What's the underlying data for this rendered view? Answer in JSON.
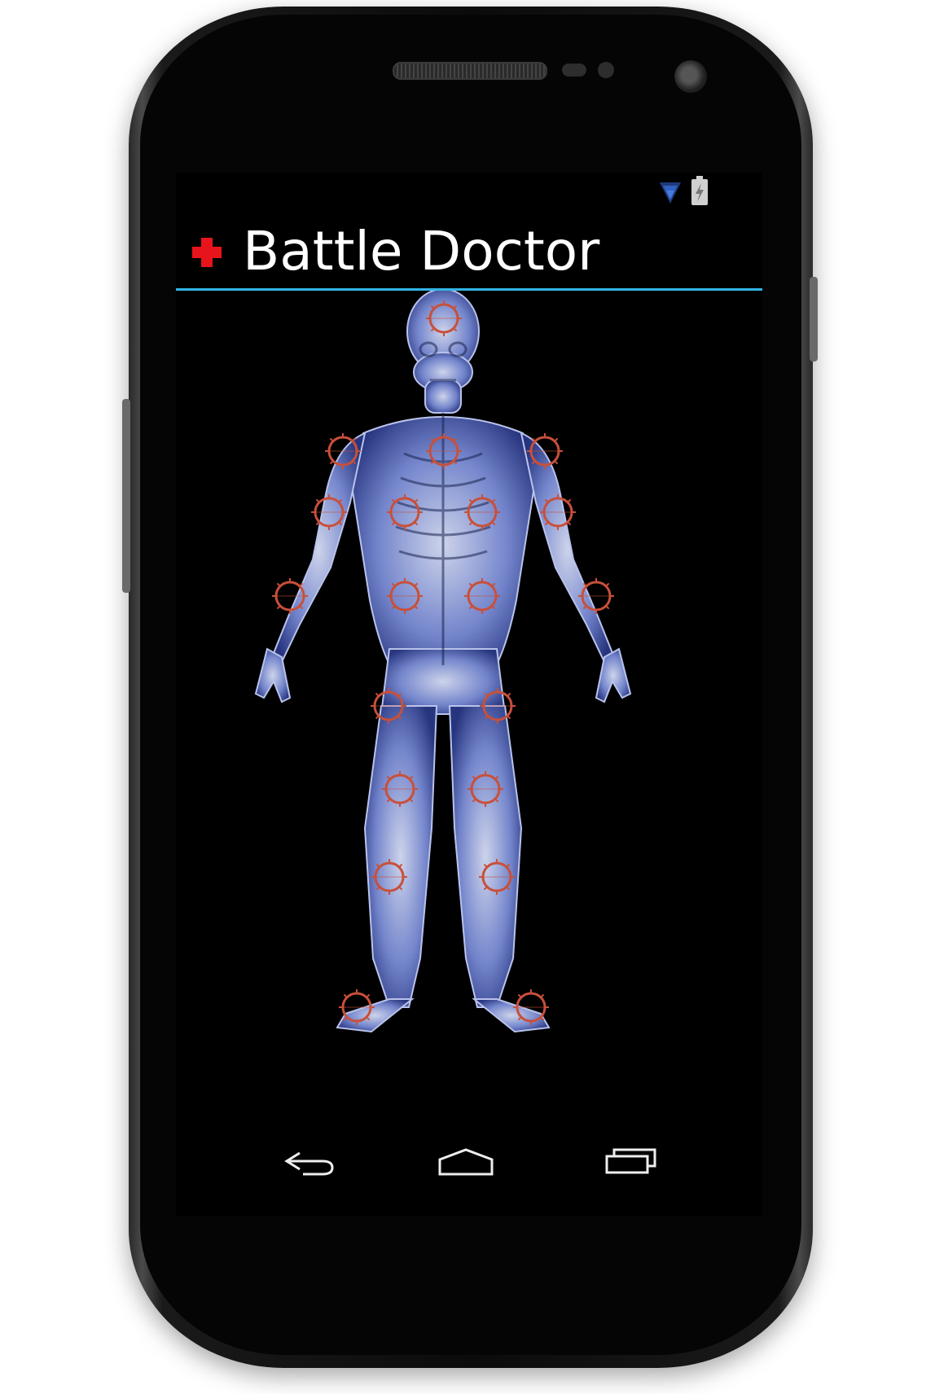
{
  "app": {
    "title": "Battle Doctor",
    "accent_color": "#33b5e5",
    "cross_color": "#e8141b",
    "hotspot_color": "#c8503a"
  },
  "status_bar": {
    "icons": [
      "wifi-icon",
      "battery-charging-icon"
    ]
  },
  "body_map": {
    "image": "xray-human-body",
    "hotspot_icon": "target-ring-icon",
    "hotspots": [
      "head",
      "right-shoulder",
      "chest",
      "left-shoulder",
      "right-upper-arm",
      "right-chest",
      "left-chest",
      "left-upper-arm",
      "right-forearm",
      "right-abdomen",
      "left-abdomen",
      "left-forearm",
      "right-thigh",
      "left-thigh",
      "right-knee",
      "left-knee",
      "right-shin",
      "left-shin",
      "right-foot",
      "left-foot"
    ]
  },
  "nav_bar": {
    "buttons": [
      "back-icon",
      "home-icon",
      "recent-apps-icon"
    ]
  }
}
